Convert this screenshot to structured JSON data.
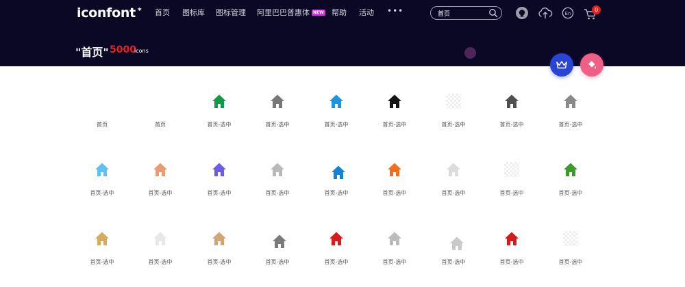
{
  "header": {
    "logo": "iconfont",
    "logo_mark": "*",
    "nav": [
      {
        "label": "首页"
      },
      {
        "label": "图标库"
      },
      {
        "label": "图标管理"
      },
      {
        "label": "阿里巴巴普惠体",
        "badge": "NEW"
      },
      {
        "label": "帮助"
      },
      {
        "label": "活动"
      }
    ],
    "more": "•••",
    "search": {
      "value": "首页",
      "placeholder": ""
    },
    "actions": [
      {
        "name": "github-icon"
      },
      {
        "name": "upload-cloud-icon"
      },
      {
        "name": "language-en-icon",
        "text": "En"
      },
      {
        "name": "cart-icon"
      }
    ],
    "cart_count": "0"
  },
  "results": {
    "title": "\"首页\"",
    "count": "5000",
    "unit": "icons"
  },
  "fabs": [
    {
      "name": "crown-icon",
      "color": "#2a44d6"
    },
    {
      "name": "paint-bucket-icon",
      "color": "#ef5f86"
    }
  ],
  "icons": [
    {
      "label": "首页",
      "color": "",
      "kind": "blank"
    },
    {
      "label": "首页",
      "color": "",
      "kind": "blank"
    },
    {
      "label": "首页-选中",
      "color": "#0e9a46",
      "kind": "house"
    },
    {
      "label": "首页-选中",
      "color": "#777777",
      "kind": "house"
    },
    {
      "label": "首页-选中",
      "color": "#1a96e0",
      "kind": "house"
    },
    {
      "label": "首页-选中",
      "color": "#141414",
      "kind": "house"
    },
    {
      "label": "首页-选中",
      "color": "",
      "kind": "checker"
    },
    {
      "label": "首页-选中",
      "color": "#4f4f4f",
      "kind": "house"
    },
    {
      "label": "首页-选中",
      "color": "#8a8a8a",
      "kind": "house"
    },
    {
      "label": "首页-选中",
      "color": "#5cc2f2",
      "kind": "house"
    },
    {
      "label": "首页-选中",
      "color": "#ec9a70",
      "kind": "house"
    },
    {
      "label": "首页-选中",
      "color": "#6a5ce8",
      "kind": "house"
    },
    {
      "label": "首页-选中",
      "color": "#b9b9b9",
      "kind": "house"
    },
    {
      "label": "首页-选中",
      "color": "#1583d4",
      "kind": "house-small"
    },
    {
      "label": "首页-选中",
      "color": "#f2701d",
      "kind": "house"
    },
    {
      "label": "首页-选中",
      "color": "#dcdcdc",
      "kind": "house"
    },
    {
      "label": "首页-选中",
      "color": "",
      "kind": "checker"
    },
    {
      "label": "首页-选中",
      "color": "#3f9a2c",
      "kind": "house"
    },
    {
      "label": "首页-选中",
      "color": "#d5aa63",
      "kind": "house"
    },
    {
      "label": "首页-选中",
      "color": "#e8e8e8",
      "kind": "house"
    },
    {
      "label": "首页-选中",
      "color": "#d0a676",
      "kind": "house"
    },
    {
      "label": "首页-选中",
      "color": "#7b7b7b",
      "kind": "house-small"
    },
    {
      "label": "首页-选中",
      "color": "#d61c1c",
      "kind": "house"
    },
    {
      "label": "首页-选中",
      "color": "#bcbcbc",
      "kind": "house"
    },
    {
      "label": "首页-选中",
      "color": "#c9c9c9",
      "kind": "house-tiny"
    },
    {
      "label": "首页-选中",
      "color": "#d11d1d",
      "kind": "house"
    },
    {
      "label": "首页-选中",
      "color": "",
      "kind": "checker"
    }
  ]
}
